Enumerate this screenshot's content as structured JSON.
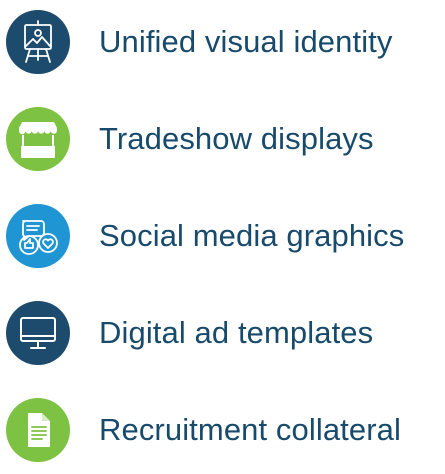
{
  "colors": {
    "navy": "#1d4b6e",
    "green": "#7dc242",
    "blue": "#1f95d3",
    "text": "#184a6b",
    "icon_stroke": "#ffffff"
  },
  "items": [
    {
      "label": "Unified visual identity",
      "icon": "easel-landscape-icon",
      "color": "#1d4b6e"
    },
    {
      "label": "Tradeshow displays",
      "icon": "booth-stand-icon",
      "color": "#7dc242"
    },
    {
      "label": "Social media graphics",
      "icon": "chat-like-heart-icon",
      "color": "#1f95d3"
    },
    {
      "label": "Digital ad templates",
      "icon": "monitor-icon",
      "color": "#1d4b6e"
    },
    {
      "label": "Recruitment collateral",
      "icon": "document-icon",
      "color": "#7dc242"
    }
  ]
}
